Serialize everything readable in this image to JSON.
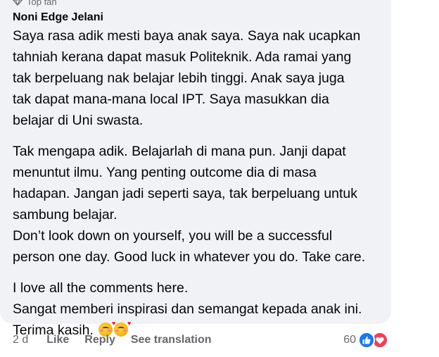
{
  "comment": {
    "badge_label": "Top fan",
    "author": "Noni Edge Jelani",
    "paragraphs": [
      "Saya rasa adik mesti baya anak saya. Saya nak ucapkan\ntahniah kerana dapat masuk Politeknik. Ada ramai yang\ntak berpeluang nak belajar lebih tinggi. Anak saya juga\ntak dapat mana-mana local IPT. Saya masukkan dia\nbelajar di Uni swasta.",
      "Tak mengapa adik. Belajarlah di mana pun. Janji dapat\nmenuntut ilmu. Yang penting outcome dia di masa\nhadapan. Jangan jadi seperti saya, tak berpeluang untuk\nsambung belajar.\nDon’t look down on yourself, you will be a successful\nperson one day. Good luck in whatever you do. Take care.",
      "I love all the comments here.\nSangat memberi inspirasi dan semangat kepada anak ini.\nTerima kasih."
    ],
    "emoji_name": "smiling-face-with-hearts",
    "time": "2 d",
    "like_label": "Like",
    "reply_label": "Reply",
    "see_translation_label": "See translation",
    "reaction_count": "60",
    "reaction_types": [
      "like",
      "love"
    ],
    "colors": {
      "bubble": "#f0f2f5",
      "text": "#050505",
      "secondary": "#65676b",
      "like_blue": "#1877f2",
      "love_red": "#f33e58"
    }
  }
}
